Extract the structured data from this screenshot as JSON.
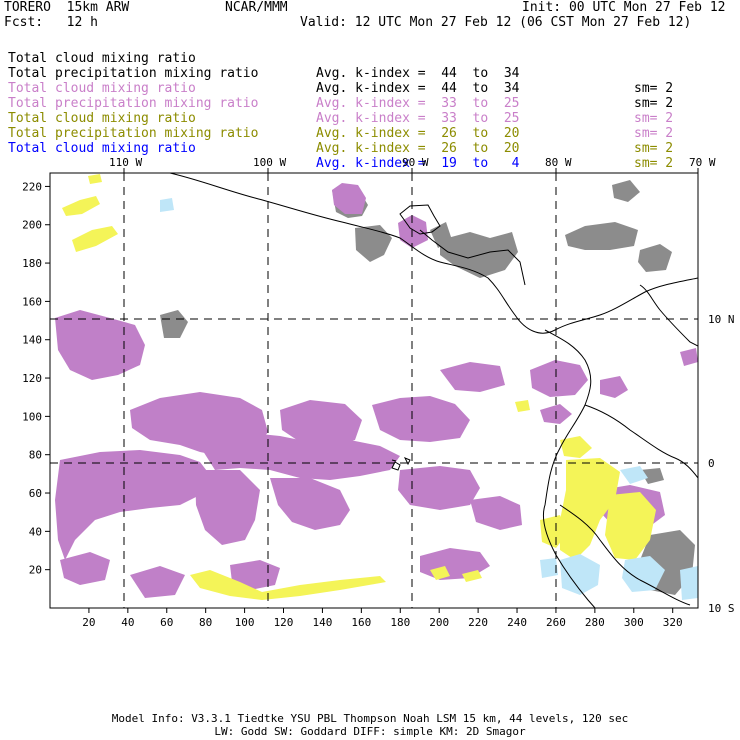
{
  "header": {
    "model": "TORERO  15km ARW",
    "center": "NCAR/MMM",
    "init": "Init: 00 UTC Mon 27 Feb 12",
    "fcst": "Fcst:   12 h",
    "valid": "Valid: 12 UTC Mon 27 Feb 12 (06 CST Mon 27 Feb 12)"
  },
  "legend": [
    {
      "field": "Total cloud mixing ratio",
      "kindex": "Avg. k-index =  44  to  34",
      "sm": "sm= 2",
      "color": "#000000"
    },
    {
      "field": "Total precipitation mixing ratio",
      "kindex": "Avg. k-index =  44  to  34",
      "sm": "sm= 2",
      "color": "#000000"
    },
    {
      "field": "Total cloud mixing ratio",
      "kindex": "Avg. k-index =  33  to  25",
      "sm": "sm= 2",
      "color": "#c97fc9"
    },
    {
      "field": "Total precipitation mixing ratio",
      "kindex": "Avg. k-index =  33  to  25",
      "sm": "sm= 2",
      "color": "#c97fc9"
    },
    {
      "field": "Total cloud mixing ratio",
      "kindex": "Avg. k-index =  26  to  20",
      "sm": "sm= 2",
      "color": "#8c8c00"
    },
    {
      "field": "Total precipitation mixing ratio",
      "kindex": "Avg. k-index =  26  to  20",
      "sm": "sm= 2",
      "color": "#8c8c00"
    },
    {
      "field": "Total cloud mixing ratio",
      "kindex": "Avg. k-index =  19  to   4",
      "sm": "",
      "color": "#0000ff"
    }
  ],
  "map": {
    "lon_labels": [
      "110 W",
      "100 W",
      "90 W",
      "80 W",
      "70 W"
    ],
    "lat_labels": [
      "10 N",
      "0",
      "10 S"
    ],
    "x_ticks": [
      "20",
      "40",
      "60",
      "80",
      "100",
      "120",
      "140",
      "160",
      "180",
      "200",
      "220",
      "240",
      "260",
      "280",
      "300",
      "320"
    ],
    "y_ticks": [
      "20",
      "40",
      "60",
      "80",
      "100",
      "120",
      "140",
      "160",
      "180",
      "200",
      "220"
    ],
    "colors": {
      "gray": "#8c8c8c",
      "purple": "#c080c8",
      "yellow": "#f4f458",
      "lightblue": "#bfe6f8",
      "coast": "#000000"
    }
  },
  "footer": {
    "line1": "Model Info: V3.3.1   Tiedtke YSU PBL  Thompson    Noah LSM  15 km,   44 levels,  120 sec",
    "line2": "LW: Godd SW: Goddard DIFF: simple KM: 2D Smagor"
  }
}
